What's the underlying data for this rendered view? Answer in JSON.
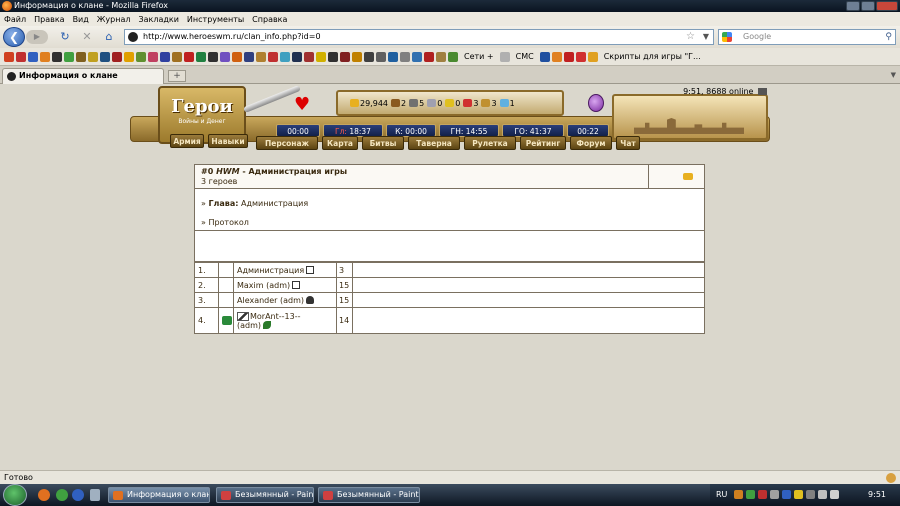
{
  "window": {
    "title": "Информация о клане - Mozilla Firefox"
  },
  "menu": [
    "Файл",
    "Правка",
    "Вид",
    "Журнал",
    "Закладки",
    "Инструменты",
    "Справка"
  ],
  "nav": {
    "url": "http://www.heroeswm.ru/clan_info.php?id=0",
    "search_placeholder": "Google"
  },
  "bookmarks": {
    "icons": [
      "#d04020",
      "#c03030",
      "#3060c0",
      "#e08020",
      "#303030",
      "#40a040",
      "#806020",
      "#c0a020",
      "#205080",
      "#a02020",
      "#e0a000",
      "#609030",
      "#c04060",
      "#3040a0",
      "#a07020",
      "#c02020",
      "#208040",
      "#303030",
      "#7050c0",
      "#d06010",
      "#304080",
      "#b08030",
      "#c03030",
      "#40a0c0",
      "#203050",
      "#a03030",
      "#d0b000",
      "#303030",
      "#802020",
      "#c08000",
      "#404040",
      "#606060",
      "#2060a0",
      "#808080",
      "#3070b0",
      "#b02020",
      "#a08040"
    ],
    "labels": [
      "Сети +",
      "СМС",
      "Скрипты для игры \"Г..."
    ]
  },
  "tab": {
    "label": "Информация о клане",
    "new_tab": "+"
  },
  "game": {
    "logo_main": "Герои",
    "logo_sub": "Войны и Денег",
    "online": "9:51, 8688 online",
    "resources": [
      {
        "icon": "gold-icon",
        "value": "29,944",
        "color": "#e8b020"
      },
      {
        "icon": "wood-icon",
        "value": "2",
        "color": "#8a5a20"
      },
      {
        "icon": "ore-icon",
        "value": "5",
        "color": "#707070"
      },
      {
        "icon": "mercury-icon",
        "value": "0",
        "color": "#a0a0b0"
      },
      {
        "icon": "sulfur-icon",
        "value": "0",
        "color": "#e0c020"
      },
      {
        "icon": "crystal-icon",
        "value": "3",
        "color": "#d03030"
      },
      {
        "icon": "gems-icon",
        "value": "3",
        "color": "#c09030"
      },
      {
        "icon": "diamond-icon",
        "value": "1",
        "color": "#60b0e0"
      }
    ],
    "timers": [
      {
        "label": "00:00",
        "red": ""
      },
      {
        "label": " 18:37",
        "red": "Гл:"
      },
      {
        "label": "К: 00:00",
        "red": ""
      },
      {
        "label": "ГН: 14:55",
        "red": ""
      },
      {
        "label": "ГО: 41:37",
        "red": ""
      },
      {
        "label": "00:22",
        "red": ""
      }
    ],
    "side_buttons": [
      "Армия",
      "Навыки"
    ],
    "nav_buttons": [
      "Персонаж",
      "Карта",
      "Битвы",
      "Таверна",
      "Рулетка",
      "Рейтинг",
      "Форум",
      "Чат"
    ]
  },
  "clan": {
    "id_label": "#0",
    "tag": "HWM",
    "name": "- Администрация игры",
    "count": "3 героев",
    "gold": "0",
    "leader_prefix": "» ",
    "leader_label": "Глава:",
    "leader_value": " Администрация",
    "log_label": "» Протокол"
  },
  "members": [
    {
      "num": "1.",
      "name": "Администрация",
      "line2": "",
      "level": "3",
      "icon": "cross-icon",
      "status": ""
    },
    {
      "num": "2.",
      "name": "Maxim (adm)",
      "line2": "",
      "level": "15",
      "icon": "cross-icon",
      "status": ""
    },
    {
      "num": "3.",
      "name": "Alexander (adm)",
      "line2": "",
      "level": "15",
      "icon": "helmet-icon",
      "status": ""
    },
    {
      "num": "4.",
      "name": "MorAnt--13--",
      "line2": "(adm)",
      "level": "14",
      "icon": "leaf-icon",
      "status": "online-icon"
    }
  ],
  "status_bar": {
    "text": "Готово"
  },
  "taskbar": {
    "tasks": [
      {
        "label": "Информация о клане ...",
        "active": true,
        "icon_color": "#e07020"
      },
      {
        "label": "Безымянный - Paint",
        "active": false,
        "icon_color": "#d04040"
      },
      {
        "label": "Безымянный - Paint",
        "active": false,
        "icon_color": "#d04040"
      }
    ],
    "lang": "RU",
    "clock": "9:51"
  }
}
